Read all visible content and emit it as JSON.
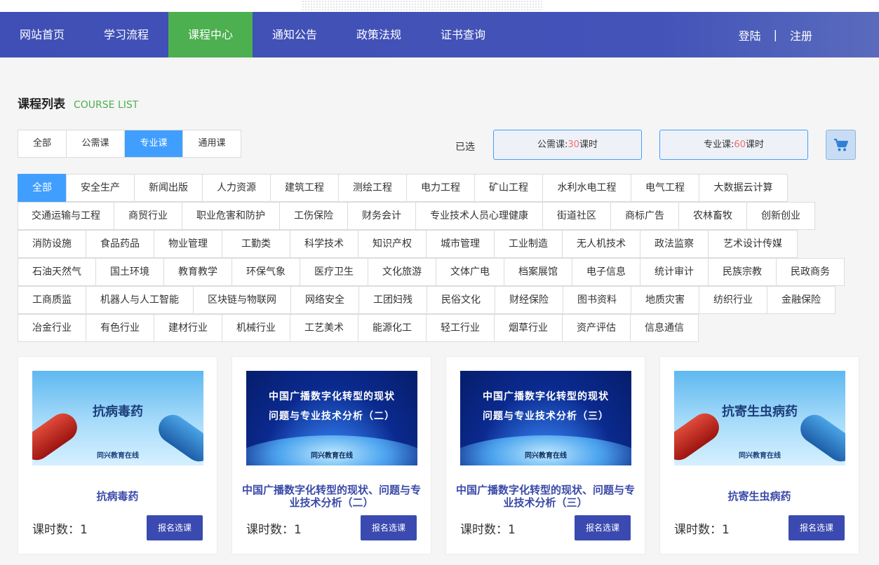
{
  "nav": {
    "items": [
      {
        "label": "网站首页"
      },
      {
        "label": "学习流程"
      },
      {
        "label": "课程中心"
      },
      {
        "label": "通知公告"
      },
      {
        "label": "政策法规"
      },
      {
        "label": "证书查询"
      }
    ],
    "active_index": 2,
    "login": "登陆",
    "separator": "|",
    "register": "注册"
  },
  "section": {
    "title_cn": "课程列表",
    "title_en": "COURSE LIST"
  },
  "type_tabs": [
    {
      "label": "全部"
    },
    {
      "label": "公需课"
    },
    {
      "label": "专业课"
    },
    {
      "label": "通用课"
    }
  ],
  "type_tab_active": 2,
  "selected": {
    "label": "已选",
    "public": {
      "prefix": "公需课:",
      "value": "30",
      "suffix": "课时"
    },
    "professional": {
      "prefix": "专业课:",
      "value": "60",
      "suffix": "课时"
    }
  },
  "cart_icon": "shopping-cart-icon",
  "categories": [
    [
      "全部",
      "安全生产",
      "新闻出版",
      "人力资源",
      "建筑工程",
      "测绘工程",
      "电力工程",
      "矿山工程",
      "水利水电工程",
      "电气工程",
      "大数据云计算"
    ],
    [
      "交通运输与工程",
      "商贸行业",
      "职业危害和防护",
      "工伤保险",
      "财务会计",
      "专业技术人员心理健康",
      "街道社区",
      "商标广告",
      "农林畜牧",
      "创新创业"
    ],
    [
      "消防设施",
      "食品药品",
      "物业管理",
      "工勤类",
      "科学技术",
      "知识产权",
      "城市管理",
      "工业制造",
      "无人机技术",
      "政法监察",
      "艺术设计传媒"
    ],
    [
      "石油天然气",
      "国土环境",
      "教育教学",
      "环保气象",
      "医疗卫生",
      "文化旅游",
      "文体广电",
      "档案展馆",
      "电子信息",
      "统计审计",
      "民族宗教",
      "民政商务"
    ],
    [
      "工商质监",
      "机器人与人工智能",
      "区块链与物联网",
      "网络安全",
      "工团妇残",
      "民俗文化",
      "财经保险",
      "图书资料",
      "地质灾害",
      "纺织行业",
      "金融保险"
    ],
    [
      "冶金行业",
      "有色行业",
      "建材行业",
      "机械行业",
      "工艺美术",
      "能源化工",
      "轻工行业",
      "烟草行业",
      "资产评估",
      "信息通信"
    ]
  ],
  "courses": [
    {
      "thumb_type": "virus",
      "thumb_title": "抗病毒药",
      "thumb_sub": "同兴教育在线",
      "thumb_line1": "",
      "thumb_line2": "",
      "title": "抗病毒药",
      "hours_label": "课时数：",
      "hours": "1",
      "button": "报名选课"
    },
    {
      "thumb_type": "tech",
      "thumb_title": "",
      "thumb_sub": "同兴教育在线",
      "thumb_line1": "中国广播数字化转型的现状",
      "thumb_line2": "问题与专业技术分析（二）",
      "title": "中国广播数字化转型的现状、问题与专业技术分析（二）",
      "hours_label": "课时数：",
      "hours": "1",
      "button": "报名选课"
    },
    {
      "thumb_type": "tech",
      "thumb_title": "",
      "thumb_sub": "同兴教育在线",
      "thumb_line1": "中国广播数字化转型的现状",
      "thumb_line2": "问题与专业技术分析（三）",
      "title": "中国广播数字化转型的现状、问题与专业技术分析（三）",
      "hours_label": "课时数：",
      "hours": "1",
      "button": "报名选课"
    },
    {
      "thumb_type": "virus",
      "thumb_title": "抗寄生虫病药",
      "thumb_sub": "同兴教育在线",
      "thumb_line1": "",
      "thumb_line2": "",
      "title": "抗寄生虫病药",
      "hours_label": "课时数：",
      "hours": "1",
      "button": "报名选课"
    }
  ],
  "colors": {
    "nav": "#3f4fb5",
    "nav_active": "#4caf50",
    "accent": "#409eff",
    "highlight": "#f56c6c",
    "button": "#3b4ab0"
  }
}
